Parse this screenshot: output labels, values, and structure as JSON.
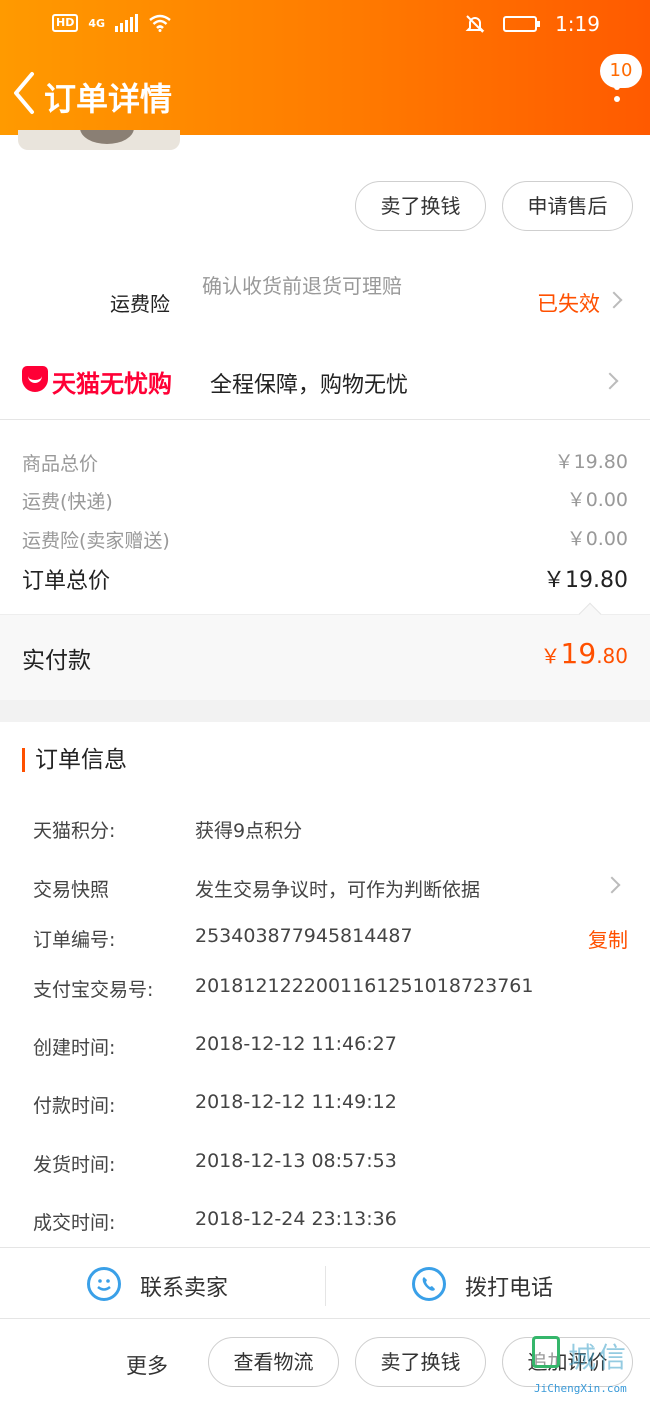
{
  "status_bar": {
    "left": "HD",
    "network": "4G",
    "time": "1:19"
  },
  "header": {
    "title": "订单详情",
    "badge_count": "10"
  },
  "top_actions": {
    "sell_exchange": "卖了换钱",
    "after_sale": "申请售后"
  },
  "shipping_insurance": {
    "label": "运费险",
    "description": "确认收货前退货可理赔",
    "status": "已失效"
  },
  "tmall_guarantee": {
    "brand": "天猫无忧购",
    "text": "全程保障，购物无忧"
  },
  "price_summary": {
    "items": [
      {
        "label": "商品总价",
        "value": "￥19.80"
      },
      {
        "label": "运费(快递)",
        "value": "￥0.00"
      },
      {
        "label": "运费险(卖家赠送)",
        "value": "￥0.00"
      }
    ],
    "total_label": "订单总价",
    "total_value": "￥19.80",
    "paid_label": "实付款",
    "paid_symbol": "￥",
    "paid_int": "19",
    "paid_dec": ".80"
  },
  "order_info": {
    "title": "订单信息",
    "rows": [
      {
        "label": "天猫积分:",
        "value": "获得9点积分"
      },
      {
        "label": "交易快照",
        "value": "发生交易争议时，可作为判断依据"
      },
      {
        "label": "订单编号:",
        "value": "253403877945814487"
      },
      {
        "label": "支付宝交易号:",
        "value": "2018121222001161251018723761"
      },
      {
        "label": "创建时间:",
        "value": "2018-12-12 11:46:27"
      },
      {
        "label": "付款时间:",
        "value": "2018-12-12 11:49:12"
      },
      {
        "label": "发货时间:",
        "value": "2018-12-13 08:57:53"
      },
      {
        "label": "成交时间:",
        "value": "2018-12-24 23:13:36"
      }
    ],
    "copy_label": "复制"
  },
  "contact": {
    "seller": "联系卖家",
    "phone": "拨打电话"
  },
  "bottom_bar": {
    "more": "更多",
    "logistics": "查看物流",
    "sell_exchange": "卖了换钱",
    "review": "追加评价"
  },
  "watermark": {
    "cn": "城信",
    "en": "JiChengXin.com"
  },
  "colors": {
    "accent": "#ff5000",
    "header_start": "#ff9a00",
    "header_end": "#ff5a00",
    "tmall_red": "#ff0036",
    "icon_blue": "#3aa0e8"
  }
}
